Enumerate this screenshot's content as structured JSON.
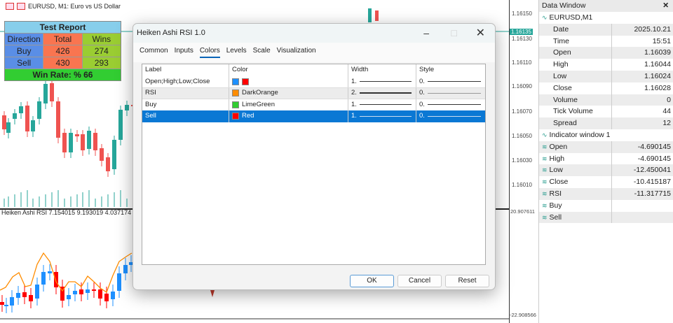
{
  "chart": {
    "title": "EURUSD, M1:  Euro vs US Dollar",
    "indicator_label": "Heiken Ashi RSI 7.154015 9.193019 4.037174 6.7130",
    "price_labels": [
      "1.16150",
      "1.16130",
      "1.16110",
      "1.16090",
      "1.16070",
      "1.16050",
      "1.16030",
      "1.16010"
    ],
    "current_price": "1.16135",
    "ind_top": "20.907611",
    "ind_bottom": "-22.908566"
  },
  "report": {
    "title": "Test Report",
    "headers": [
      "Direction",
      "Total",
      "Wins"
    ],
    "rows": [
      [
        "Buy",
        "426",
        "274"
      ],
      [
        "Sell",
        "430",
        "293"
      ]
    ],
    "win_rate": "Win Rate: %  66"
  },
  "dialog": {
    "title": "Heiken Ashi RSI 1.0",
    "tabs": [
      "Common",
      "Inputs",
      "Colors",
      "Levels",
      "Scale",
      "Visualization"
    ],
    "active_tab": "Colors",
    "columns": [
      "Label",
      "Color",
      "Width",
      "Style"
    ],
    "rows": [
      {
        "label": "Open;High;Low;Close",
        "colors": [
          "#1e90ff",
          "#ff0000"
        ],
        "color_name": "",
        "width": "1.",
        "style": "0."
      },
      {
        "label": "RSI",
        "colors": [
          "#ff8c00"
        ],
        "color_name": "DarkOrange",
        "width": "2.",
        "style": "0."
      },
      {
        "label": "Buy",
        "colors": [
          "#32cd32"
        ],
        "color_name": "LimeGreen",
        "width": "1.",
        "style": "0."
      },
      {
        "label": "Sell",
        "colors": [
          "#ff0000"
        ],
        "color_name": "Red",
        "width": "1.",
        "style": "0."
      }
    ],
    "buttons": {
      "ok": "OK",
      "cancel": "Cancel",
      "reset": "Reset"
    }
  },
  "data_window": {
    "title": "Data Window",
    "symbol": "EURUSD,M1",
    "rows": [
      [
        "Date",
        "2025.10.21"
      ],
      [
        "Time",
        "15:51"
      ],
      [
        "Open",
        "1.16039"
      ],
      [
        "High",
        "1.16044"
      ],
      [
        "Low",
        "1.16024"
      ],
      [
        "Close",
        "1.16028"
      ],
      [
        "Volume",
        "0"
      ],
      [
        "Tick Volume",
        "44"
      ],
      [
        "Spread",
        "12"
      ]
    ],
    "indicator": "Indicator window 1",
    "ind_rows": [
      [
        "Open",
        "-4.690145"
      ],
      [
        "High",
        "-4.690145"
      ],
      [
        "Low",
        "-12.450041"
      ],
      [
        "Close",
        "-10.415187"
      ],
      [
        "RSI",
        "-11.317715"
      ],
      [
        "Buy",
        ""
      ],
      [
        "Sell",
        ""
      ]
    ]
  }
}
